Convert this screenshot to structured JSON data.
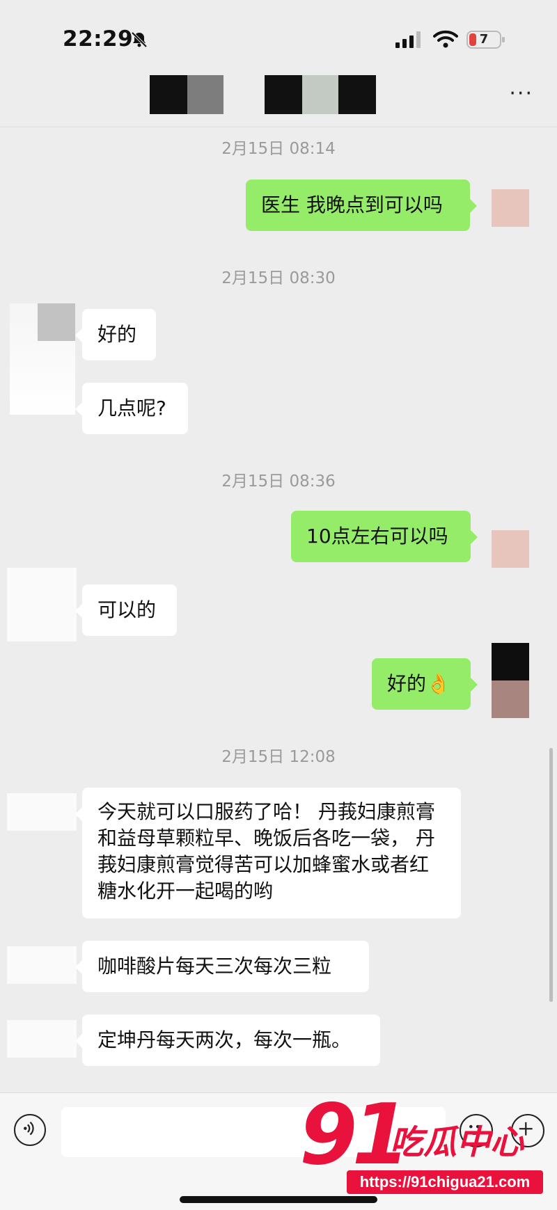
{
  "status_bar": {
    "time": "22:29",
    "battery": "7"
  },
  "nav": {
    "more": "···"
  },
  "messages": [
    {
      "timestamp": "2月15日 08:14"
    },
    {
      "text": "医生 我晚点到可以吗"
    },
    {
      "timestamp": "2月15日 08:30"
    },
    {
      "text": "好的"
    },
    {
      "text": "几点呢?"
    },
    {
      "timestamp": "2月15日 08:36"
    },
    {
      "text": "10点左右可以吗"
    },
    {
      "text": "可以的"
    },
    {
      "text": "好的👌"
    },
    {
      "timestamp": "2月15日 12:08"
    },
    {
      "text": "今天就可以口服药了哈！    丹莪妇康煎膏和益母草颗粒早、晚饭后各吃一袋， 丹莪妇康煎膏觉得苦可以加蜂蜜水或者红糖水化开一起喝的哟"
    },
    {
      "text": "咖啡酸片每天三次每次三粒"
    },
    {
      "text": "定坤丹每天两次，每次一瓶。"
    }
  ],
  "watermark": {
    "number": "91",
    "brand": "吃瓜中心",
    "url": "https://91chigua21.com"
  },
  "colors": {
    "outgoing": "#95ec69",
    "incoming": "#ffffff",
    "background": "#ededed",
    "watermark": "#e8123c"
  }
}
